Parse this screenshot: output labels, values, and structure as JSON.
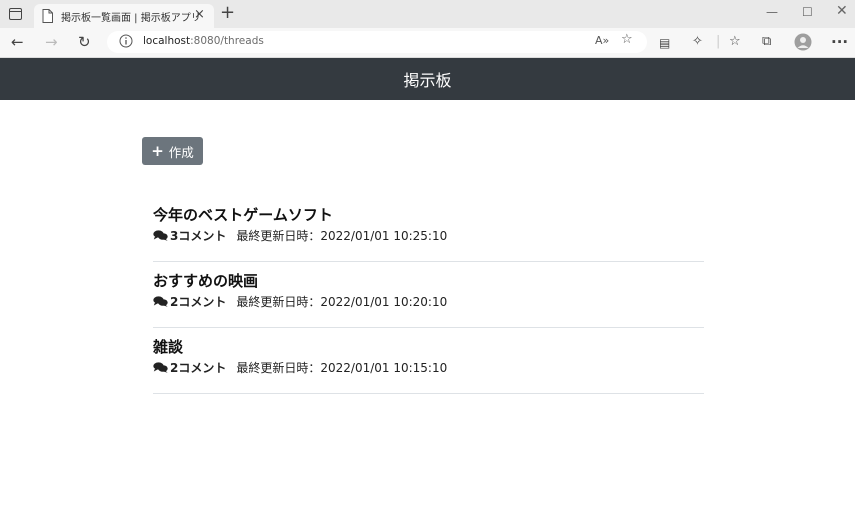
{
  "browser": {
    "tab_title": "掲示板一覧画面 | 掲示板アプリ",
    "tab_close": "×",
    "new_tab": "+",
    "url_host": "localhost",
    "url_path": ":8080/threads",
    "icons": [
      "tab-actions-icon",
      "page-icon",
      "back-icon",
      "forward-icon",
      "refresh-icon",
      "info-icon",
      "read-aloud-icon",
      "add-favorite-icon",
      "immersive-reader-icon",
      "extensions-icon",
      "favorites-icon",
      "collections-icon",
      "profile-icon",
      "more-icon",
      "minimize-icon",
      "maximize-icon",
      "close-icon"
    ]
  },
  "header": {
    "title": "掲示板"
  },
  "toolbar": {
    "create_label": "作成"
  },
  "threads": [
    {
      "title": "今年のベストゲームソフト",
      "comments": "3コメント",
      "updated": "最終更新日時：2022/01/01 10:25:10"
    },
    {
      "title": "おすすめの映画",
      "comments": "2コメント",
      "updated": "最終更新日時：2022/01/01 10:20:10"
    },
    {
      "title": "雑談",
      "comments": "2コメント",
      "updated": "最終更新日時：2022/01/01 10:15:10"
    }
  ],
  "colors": {
    "header_bg": "#343a40",
    "button_bg": "#6c757d",
    "divider": "#dee2e6"
  }
}
